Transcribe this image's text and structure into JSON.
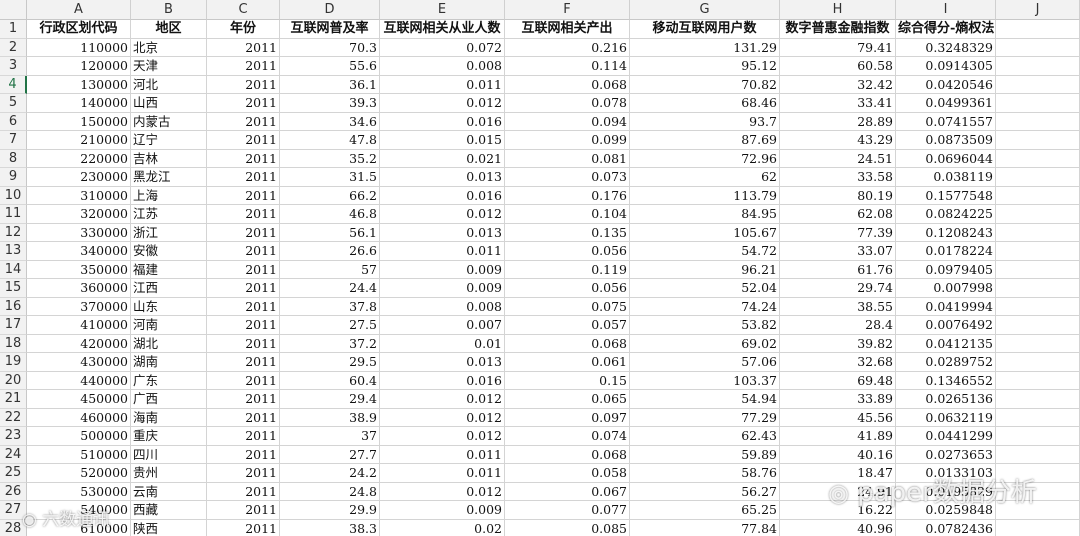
{
  "columns": [
    "A",
    "B",
    "C",
    "D",
    "E",
    "F",
    "G",
    "H",
    "I",
    "J"
  ],
  "row_numbers": [
    "1",
    "2",
    "3",
    "4",
    "5",
    "6",
    "7",
    "8",
    "9",
    "10",
    "11",
    "12",
    "13",
    "14",
    "15",
    "16",
    "17",
    "18",
    "19",
    "20",
    "21",
    "22",
    "23",
    "24",
    "25",
    "26",
    "27",
    "28"
  ],
  "active_row": "4",
  "header_row": [
    "行政区划代码",
    "地区",
    "年份",
    "互联网普及率",
    "互联网相关从业人数",
    "互联网相关产出",
    "移动互联网用户数",
    "数字普惠金融指数",
    "综合得分-熵权法",
    ""
  ],
  "rows": [
    [
      "110000",
      "北京",
      "2011",
      "70.3",
      "0.072",
      "0.216",
      "131.29",
      "79.41",
      "0.3248329"
    ],
    [
      "120000",
      "天津",
      "2011",
      "55.6",
      "0.008",
      "0.114",
      "95.12",
      "60.58",
      "0.0914305"
    ],
    [
      "130000",
      "河北",
      "2011",
      "36.1",
      "0.011",
      "0.068",
      "70.82",
      "32.42",
      "0.0420546"
    ],
    [
      "140000",
      "山西",
      "2011",
      "39.3",
      "0.012",
      "0.078",
      "68.46",
      "33.41",
      "0.0499361"
    ],
    [
      "150000",
      "内蒙古",
      "2011",
      "34.6",
      "0.016",
      "0.094",
      "93.7",
      "28.89",
      "0.0741557"
    ],
    [
      "210000",
      "辽宁",
      "2011",
      "47.8",
      "0.015",
      "0.099",
      "87.69",
      "43.29",
      "0.0873509"
    ],
    [
      "220000",
      "吉林",
      "2011",
      "35.2",
      "0.021",
      "0.081",
      "72.96",
      "24.51",
      "0.0696044"
    ],
    [
      "230000",
      "黑龙江",
      "2011",
      "31.5",
      "0.013",
      "0.073",
      "62",
      "33.58",
      "0.038119"
    ],
    [
      "310000",
      "上海",
      "2011",
      "66.2",
      "0.016",
      "0.176",
      "113.79",
      "80.19",
      "0.1577548"
    ],
    [
      "320000",
      "江苏",
      "2011",
      "46.8",
      "0.012",
      "0.104",
      "84.95",
      "62.08",
      "0.0824225"
    ],
    [
      "330000",
      "浙江",
      "2011",
      "56.1",
      "0.013",
      "0.135",
      "105.67",
      "77.39",
      "0.1208243"
    ],
    [
      "340000",
      "安徽",
      "2011",
      "26.6",
      "0.011",
      "0.056",
      "54.72",
      "33.07",
      "0.0178224"
    ],
    [
      "350000",
      "福建",
      "2011",
      "57",
      "0.009",
      "0.119",
      "96.21",
      "61.76",
      "0.0979405"
    ],
    [
      "360000",
      "江西",
      "2011",
      "24.4",
      "0.009",
      "0.056",
      "52.04",
      "29.74",
      "0.007998"
    ],
    [
      "370000",
      "山东",
      "2011",
      "37.8",
      "0.008",
      "0.075",
      "74.24",
      "38.55",
      "0.0419994"
    ],
    [
      "410000",
      "河南",
      "2011",
      "27.5",
      "0.007",
      "0.057",
      "53.82",
      "28.4",
      "0.0076492"
    ],
    [
      "420000",
      "湖北",
      "2011",
      "37.2",
      "0.01",
      "0.068",
      "69.02",
      "39.82",
      "0.0412135"
    ],
    [
      "430000",
      "湖南",
      "2011",
      "29.5",
      "0.013",
      "0.061",
      "57.06",
      "32.68",
      "0.0289752"
    ],
    [
      "440000",
      "广东",
      "2011",
      "60.4",
      "0.016",
      "0.15",
      "103.37",
      "69.48",
      "0.1346552"
    ],
    [
      "450000",
      "广西",
      "2011",
      "29.4",
      "0.012",
      "0.065",
      "54.94",
      "33.89",
      "0.0265136"
    ],
    [
      "460000",
      "海南",
      "2011",
      "38.9",
      "0.012",
      "0.097",
      "77.29",
      "45.56",
      "0.0632119"
    ],
    [
      "500000",
      "重庆",
      "2011",
      "37",
      "0.012",
      "0.074",
      "62.43",
      "41.89",
      "0.0441299"
    ],
    [
      "510000",
      "四川",
      "2011",
      "27.7",
      "0.011",
      "0.068",
      "59.89",
      "40.16",
      "0.0273653"
    ],
    [
      "520000",
      "贵州",
      "2011",
      "24.2",
      "0.011",
      "0.058",
      "58.76",
      "18.47",
      "0.0133103"
    ],
    [
      "530000",
      "云南",
      "2011",
      "24.8",
      "0.012",
      "0.067",
      "56.27",
      "24.91",
      "0.0195829"
    ],
    [
      "540000",
      "西藏",
      "2011",
      "29.9",
      "0.009",
      "0.077",
      "65.25",
      "16.22",
      "0.0259848"
    ],
    [
      "610000",
      "陕西",
      "2011",
      "38.3",
      "0.02",
      "0.085",
      "77.84",
      "40.96",
      "0.0782436"
    ]
  ],
  "watermarks": {
    "right": "paper数据分析",
    "left": "六数通讯"
  }
}
